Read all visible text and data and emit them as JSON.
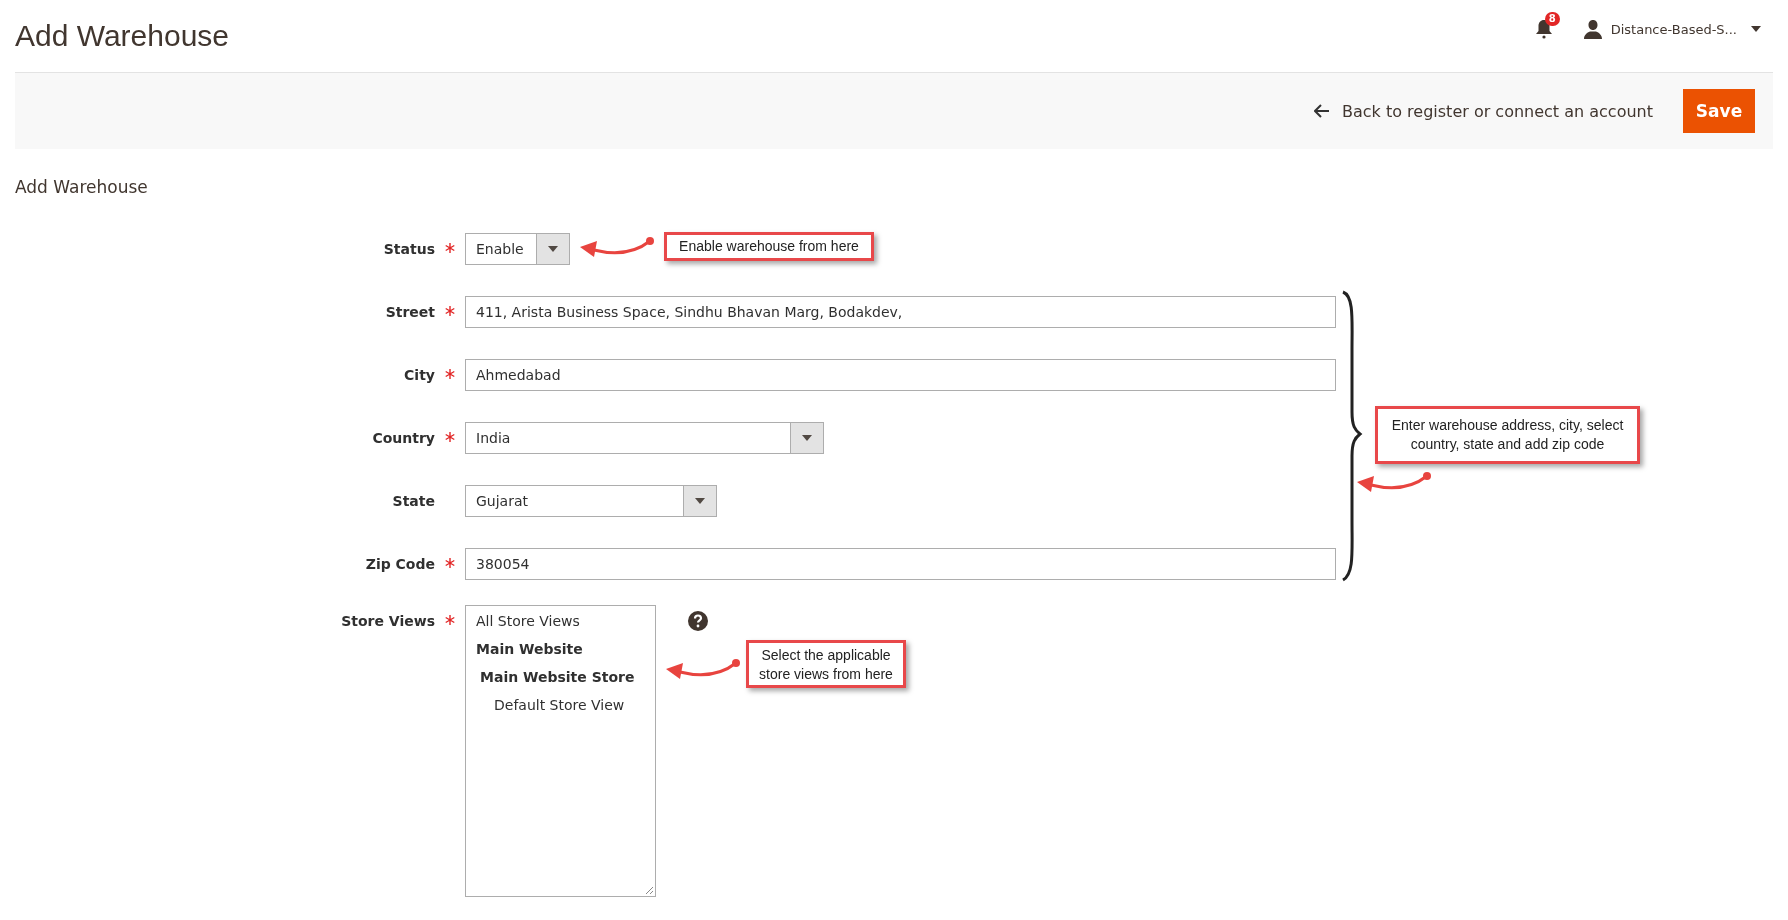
{
  "page_title": "Add Warehouse",
  "header": {
    "notification_count": "8",
    "user_name": "Distance-Based-S..."
  },
  "action_bar": {
    "back_link": "Back to register or connect an account",
    "save_button": "Save"
  },
  "section_title": "Add Warehouse",
  "fields": [
    {
      "kind": "select",
      "label": "Status",
      "required": true,
      "value": "Enable"
    },
    {
      "kind": "text",
      "label": "Street",
      "required": true,
      "value": "411, Arista Business Space, Sindhu Bhavan Marg, Bodakdev,"
    },
    {
      "kind": "text",
      "label": "City",
      "required": true,
      "value": "Ahmedabad"
    },
    {
      "kind": "select",
      "label": "Country",
      "required": true,
      "value": "India"
    },
    {
      "kind": "select",
      "label": "State",
      "required": false,
      "value": "Gujarat"
    },
    {
      "kind": "text",
      "label": "Zip Code",
      "required": true,
      "value": "380054"
    },
    {
      "kind": "multiselect",
      "label": "Store Views",
      "required": true,
      "help_icon": true,
      "options": [
        {
          "label": "All Store Views",
          "kind": "option",
          "selected": false
        },
        {
          "label": "Main Website",
          "kind": "group",
          "selected": false,
          "children": [
            {
              "label": "Main Website Store",
              "kind": "group",
              "selected": false,
              "children": [
                {
                  "label": "Default Store View",
                  "kind": "option",
                  "selected": false
                }
              ]
            }
          ]
        }
      ]
    }
  ],
  "annotations": [
    {
      "text": "Enable warehouse from here"
    },
    {
      "text": "Enter warehouse address, city, select country, state and add zip code"
    },
    {
      "text": "Select the applicable store views from here"
    }
  ]
}
